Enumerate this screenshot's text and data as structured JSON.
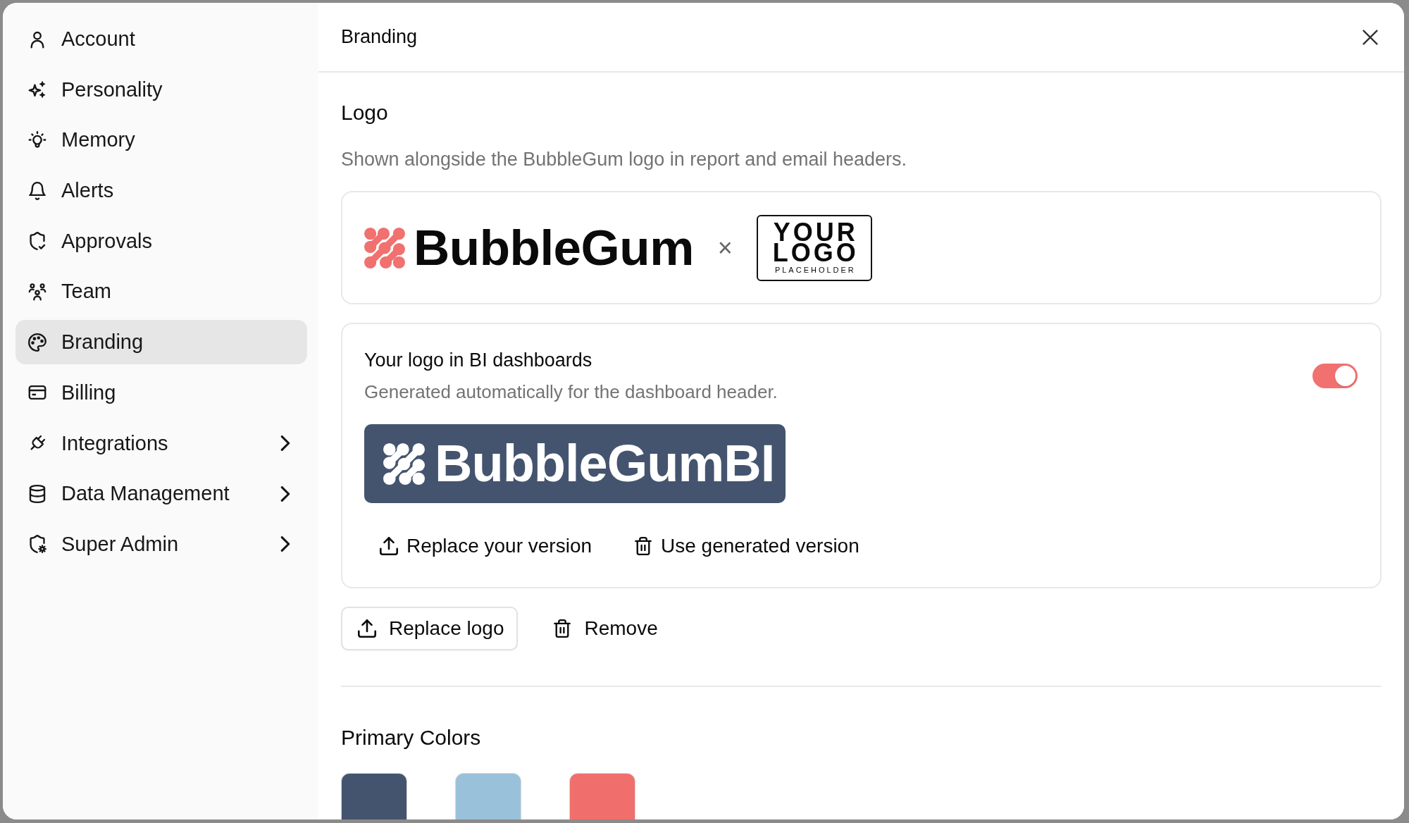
{
  "sidebar": {
    "items": [
      {
        "label": "Account",
        "selected": false,
        "expandable": false
      },
      {
        "label": "Personality",
        "selected": false,
        "expandable": false
      },
      {
        "label": "Memory",
        "selected": false,
        "expandable": false
      },
      {
        "label": "Alerts",
        "selected": false,
        "expandable": false
      },
      {
        "label": "Approvals",
        "selected": false,
        "expandable": false
      },
      {
        "label": "Team",
        "selected": false,
        "expandable": false
      },
      {
        "label": "Branding",
        "selected": true,
        "expandable": false
      },
      {
        "label": "Billing",
        "selected": false,
        "expandable": false
      },
      {
        "label": "Integrations",
        "selected": false,
        "expandable": true
      },
      {
        "label": "Data Management",
        "selected": false,
        "expandable": true
      },
      {
        "label": "Super Admin",
        "selected": false,
        "expandable": true
      }
    ]
  },
  "panel": {
    "title": "Branding"
  },
  "logo_section": {
    "title": "Logo",
    "description": "Shown alongside the BubbleGum logo in report and email headers.",
    "preview": {
      "brand_name": "BubbleGum",
      "separator": "×",
      "placeholder": {
        "lines": [
          "YOUR",
          "LOGO"
        ],
        "caption": "PLACEHOLDER"
      }
    },
    "bi_card": {
      "title": "Your logo in BI dashboards",
      "description": "Generated automatically for the dashboard header.",
      "enabled": true,
      "logo_text": "BubbleGumBI",
      "actions": [
        {
          "label": "Replace your version"
        },
        {
          "label": "Use generated version"
        }
      ]
    },
    "buttons": [
      {
        "label": "Replace logo",
        "kind": "outlined"
      },
      {
        "label": "Remove",
        "kind": "ghost"
      }
    ]
  },
  "primary_colors": {
    "title": "Primary Colors",
    "swatches": [
      {
        "color": "#44546f"
      },
      {
        "color": "#9ac1da"
      },
      {
        "color": "#f06f6c"
      }
    ]
  }
}
